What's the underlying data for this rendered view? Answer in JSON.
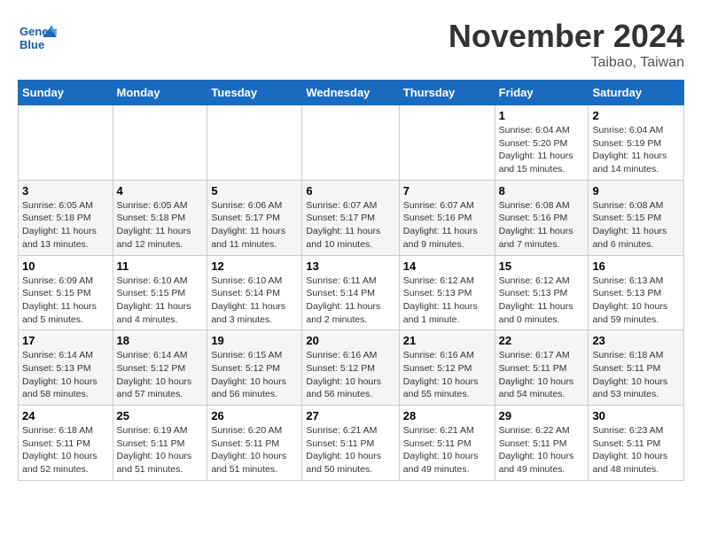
{
  "header": {
    "logo_text_1": "General",
    "logo_text_2": "Blue",
    "month": "November 2024",
    "location": "Taibao, Taiwan"
  },
  "days_of_week": [
    "Sunday",
    "Monday",
    "Tuesday",
    "Wednesday",
    "Thursday",
    "Friday",
    "Saturday"
  ],
  "weeks": [
    [
      {
        "day": "",
        "info": ""
      },
      {
        "day": "",
        "info": ""
      },
      {
        "day": "",
        "info": ""
      },
      {
        "day": "",
        "info": ""
      },
      {
        "day": "",
        "info": ""
      },
      {
        "day": "1",
        "info": "Sunrise: 6:04 AM\nSunset: 5:20 PM\nDaylight: 11 hours and 15 minutes."
      },
      {
        "day": "2",
        "info": "Sunrise: 6:04 AM\nSunset: 5:19 PM\nDaylight: 11 hours and 14 minutes."
      }
    ],
    [
      {
        "day": "3",
        "info": "Sunrise: 6:05 AM\nSunset: 5:18 PM\nDaylight: 11 hours and 13 minutes."
      },
      {
        "day": "4",
        "info": "Sunrise: 6:05 AM\nSunset: 5:18 PM\nDaylight: 11 hours and 12 minutes."
      },
      {
        "day": "5",
        "info": "Sunrise: 6:06 AM\nSunset: 5:17 PM\nDaylight: 11 hours and 11 minutes."
      },
      {
        "day": "6",
        "info": "Sunrise: 6:07 AM\nSunset: 5:17 PM\nDaylight: 11 hours and 10 minutes."
      },
      {
        "day": "7",
        "info": "Sunrise: 6:07 AM\nSunset: 5:16 PM\nDaylight: 11 hours and 9 minutes."
      },
      {
        "day": "8",
        "info": "Sunrise: 6:08 AM\nSunset: 5:16 PM\nDaylight: 11 hours and 7 minutes."
      },
      {
        "day": "9",
        "info": "Sunrise: 6:08 AM\nSunset: 5:15 PM\nDaylight: 11 hours and 6 minutes."
      }
    ],
    [
      {
        "day": "10",
        "info": "Sunrise: 6:09 AM\nSunset: 5:15 PM\nDaylight: 11 hours and 5 minutes."
      },
      {
        "day": "11",
        "info": "Sunrise: 6:10 AM\nSunset: 5:15 PM\nDaylight: 11 hours and 4 minutes."
      },
      {
        "day": "12",
        "info": "Sunrise: 6:10 AM\nSunset: 5:14 PM\nDaylight: 11 hours and 3 minutes."
      },
      {
        "day": "13",
        "info": "Sunrise: 6:11 AM\nSunset: 5:14 PM\nDaylight: 11 hours and 2 minutes."
      },
      {
        "day": "14",
        "info": "Sunrise: 6:12 AM\nSunset: 5:13 PM\nDaylight: 11 hours and 1 minute."
      },
      {
        "day": "15",
        "info": "Sunrise: 6:12 AM\nSunset: 5:13 PM\nDaylight: 11 hours and 0 minutes."
      },
      {
        "day": "16",
        "info": "Sunrise: 6:13 AM\nSunset: 5:13 PM\nDaylight: 10 hours and 59 minutes."
      }
    ],
    [
      {
        "day": "17",
        "info": "Sunrise: 6:14 AM\nSunset: 5:13 PM\nDaylight: 10 hours and 58 minutes."
      },
      {
        "day": "18",
        "info": "Sunrise: 6:14 AM\nSunset: 5:12 PM\nDaylight: 10 hours and 57 minutes."
      },
      {
        "day": "19",
        "info": "Sunrise: 6:15 AM\nSunset: 5:12 PM\nDaylight: 10 hours and 56 minutes."
      },
      {
        "day": "20",
        "info": "Sunrise: 6:16 AM\nSunset: 5:12 PM\nDaylight: 10 hours and 56 minutes."
      },
      {
        "day": "21",
        "info": "Sunrise: 6:16 AM\nSunset: 5:12 PM\nDaylight: 10 hours and 55 minutes."
      },
      {
        "day": "22",
        "info": "Sunrise: 6:17 AM\nSunset: 5:11 PM\nDaylight: 10 hours and 54 minutes."
      },
      {
        "day": "23",
        "info": "Sunrise: 6:18 AM\nSunset: 5:11 PM\nDaylight: 10 hours and 53 minutes."
      }
    ],
    [
      {
        "day": "24",
        "info": "Sunrise: 6:18 AM\nSunset: 5:11 PM\nDaylight: 10 hours and 52 minutes."
      },
      {
        "day": "25",
        "info": "Sunrise: 6:19 AM\nSunset: 5:11 PM\nDaylight: 10 hours and 51 minutes."
      },
      {
        "day": "26",
        "info": "Sunrise: 6:20 AM\nSunset: 5:11 PM\nDaylight: 10 hours and 51 minutes."
      },
      {
        "day": "27",
        "info": "Sunrise: 6:21 AM\nSunset: 5:11 PM\nDaylight: 10 hours and 50 minutes."
      },
      {
        "day": "28",
        "info": "Sunrise: 6:21 AM\nSunset: 5:11 PM\nDaylight: 10 hours and 49 minutes."
      },
      {
        "day": "29",
        "info": "Sunrise: 6:22 AM\nSunset: 5:11 PM\nDaylight: 10 hours and 49 minutes."
      },
      {
        "day": "30",
        "info": "Sunrise: 6:23 AM\nSunset: 5:11 PM\nDaylight: 10 hours and 48 minutes."
      }
    ]
  ]
}
